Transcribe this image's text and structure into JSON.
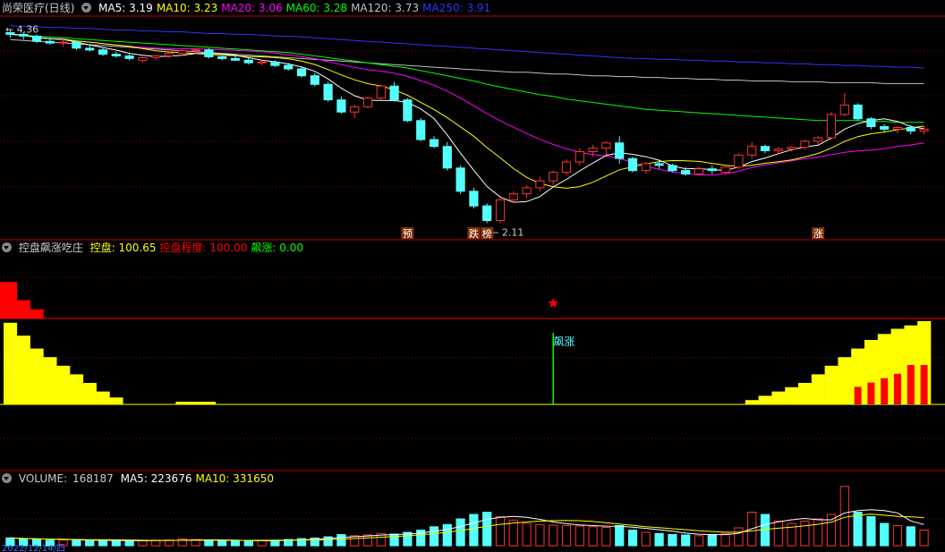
{
  "colors": {
    "up": "#ff3232",
    "down": "#54ffff",
    "ma5": "#ffffff",
    "ma10": "#ffff00",
    "ma20": "#ff00ff",
    "ma60": "#00ff00",
    "ma120": "#c0c0c0",
    "ma250": "#3232ff",
    "grid": "#800000",
    "panelBorder": "#c00000",
    "yellow": "#ffff00",
    "red": "#ff0000",
    "green": "#00ff00",
    "cyan": "#54ffff"
  },
  "main_panel": {
    "title": "尚荣医疗(日线)",
    "items": [
      {
        "label": "MA5:",
        "value": "3.19",
        "color": "#ffffff"
      },
      {
        "label": "MA10:",
        "value": "3.23",
        "color": "#ffff00"
      },
      {
        "label": "MA20:",
        "value": "3.06",
        "color": "#ff00ff"
      },
      {
        "label": "MA60:",
        "value": "3.28",
        "color": "#00ff00"
      },
      {
        "label": "MA120:",
        "value": "3.73",
        "color": "#c0c0c0"
      },
      {
        "label": "MA250:",
        "value": "3.91",
        "color": "#3232ff"
      }
    ],
    "high_label": "4.36",
    "low_label": "2.11",
    "markers": [
      {
        "text": "预",
        "i": 30
      },
      {
        "text": "跌",
        "i": 35
      },
      {
        "text": "榜",
        "i": 36
      },
      {
        "text": "涨",
        "i": 61
      }
    ]
  },
  "indicator_panel": {
    "title": "控盘飙涨吃庄",
    "items": [
      {
        "label": "控盘:",
        "value": "100.65",
        "color": "#ffff00"
      },
      {
        "label": "控盘程度:",
        "value": "100.00",
        "color": "#ff0000"
      },
      {
        "label": "飙涨:",
        "value": "0.00",
        "color": "#00ff00"
      }
    ],
    "signal_label": "飙涨"
  },
  "volume_panel": {
    "title": "VOLUME:",
    "value": "168187",
    "items": [
      {
        "label": "MA5:",
        "value": "223676",
        "color": "#ffffff"
      },
      {
        "label": "MA10:",
        "value": "331650",
        "color": "#ffff00"
      }
    ],
    "date_label": "2022/12/14/四"
  },
  "chart_data": {
    "type": "candlestick",
    "count": 70,
    "ylim": [
      2.0,
      4.45
    ],
    "ohlc": [
      [
        4.32,
        4.36,
        4.26,
        4.3
      ],
      [
        4.3,
        4.33,
        4.24,
        4.28
      ],
      [
        4.28,
        4.3,
        4.2,
        4.22
      ],
      [
        4.22,
        4.26,
        4.18,
        4.2
      ],
      [
        4.2,
        4.24,
        4.16,
        4.21
      ],
      [
        4.21,
        4.23,
        4.12,
        4.14
      ],
      [
        4.14,
        4.18,
        4.1,
        4.12
      ],
      [
        4.12,
        4.14,
        4.05,
        4.07
      ],
      [
        4.07,
        4.1,
        4.03,
        4.05
      ],
      [
        4.05,
        4.07,
        4.0,
        4.02
      ],
      [
        4.0,
        4.04,
        3.97,
        4.03
      ],
      [
        4.03,
        4.06,
        4.0,
        4.05
      ],
      [
        4.05,
        4.1,
        4.03,
        4.08
      ],
      [
        4.08,
        4.13,
        4.05,
        4.11
      ],
      [
        4.11,
        4.14,
        4.07,
        4.12
      ],
      [
        4.12,
        4.14,
        4.02,
        4.04
      ],
      [
        4.04,
        4.06,
        4.0,
        4.02
      ],
      [
        4.02,
        4.05,
        3.99,
        4.0
      ],
      [
        4.0,
        4.03,
        3.95,
        3.97
      ],
      [
        3.97,
        4.0,
        3.94,
        3.98
      ],
      [
        3.98,
        4.0,
        3.92,
        3.94
      ],
      [
        3.94,
        3.97,
        3.88,
        3.9
      ],
      [
        3.9,
        3.93,
        3.8,
        3.82
      ],
      [
        3.82,
        3.85,
        3.7,
        3.72
      ],
      [
        3.72,
        3.75,
        3.52,
        3.54
      ],
      [
        3.54,
        3.58,
        3.38,
        3.4
      ],
      [
        3.4,
        3.48,
        3.33,
        3.46
      ],
      [
        3.46,
        3.58,
        3.44,
        3.56
      ],
      [
        3.56,
        3.72,
        3.53,
        3.7
      ],
      [
        3.7,
        3.75,
        3.52,
        3.54
      ],
      [
        3.54,
        3.56,
        3.28,
        3.3
      ],
      [
        3.3,
        3.33,
        3.06,
        3.08
      ],
      [
        3.08,
        3.12,
        2.98,
        3.0
      ],
      [
        3.0,
        3.05,
        2.72,
        2.75
      ],
      [
        2.75,
        2.78,
        2.45,
        2.48
      ],
      [
        2.48,
        2.52,
        2.28,
        2.31
      ],
      [
        2.31,
        2.34,
        2.11,
        2.14
      ],
      [
        2.14,
        2.4,
        2.11,
        2.38
      ],
      [
        2.38,
        2.48,
        2.34,
        2.45
      ],
      [
        2.45,
        2.55,
        2.4,
        2.52
      ],
      [
        2.52,
        2.65,
        2.48,
        2.6
      ],
      [
        2.6,
        2.72,
        2.55,
        2.7
      ],
      [
        2.7,
        2.85,
        2.66,
        2.82
      ],
      [
        2.82,
        2.98,
        2.78,
        2.94
      ],
      [
        2.94,
        3.02,
        2.88,
        2.98
      ],
      [
        2.98,
        3.06,
        2.9,
        3.04
      ],
      [
        3.04,
        3.12,
        2.8,
        2.86
      ],
      [
        2.86,
        2.88,
        2.7,
        2.72
      ],
      [
        2.72,
        2.82,
        2.68,
        2.8
      ],
      [
        2.8,
        2.84,
        2.74,
        2.78
      ],
      [
        2.78,
        2.8,
        2.7,
        2.72
      ],
      [
        2.72,
        2.76,
        2.66,
        2.68
      ],
      [
        2.68,
        2.76,
        2.66,
        2.74
      ],
      [
        2.74,
        2.78,
        2.68,
        2.72
      ],
      [
        2.7,
        2.78,
        2.68,
        2.76
      ],
      [
        2.76,
        2.92,
        2.74,
        2.9
      ],
      [
        2.9,
        3.05,
        2.86,
        3.0
      ],
      [
        3.0,
        3.02,
        2.92,
        2.95
      ],
      [
        2.95,
        2.99,
        2.9,
        2.97
      ],
      [
        2.97,
        3.0,
        2.94,
        2.99
      ],
      [
        2.99,
        3.08,
        2.96,
        3.06
      ],
      [
        3.06,
        3.12,
        3.02,
        3.1
      ],
      [
        3.1,
        3.4,
        3.08,
        3.37
      ],
      [
        3.37,
        3.62,
        3.35,
        3.48
      ],
      [
        3.48,
        3.5,
        3.3,
        3.32
      ],
      [
        3.32,
        3.34,
        3.2,
        3.23
      ],
      [
        3.23,
        3.26,
        3.16,
        3.2
      ],
      [
        3.2,
        3.24,
        3.15,
        3.22
      ],
      [
        3.22,
        3.25,
        3.14,
        3.18
      ],
      [
        3.18,
        3.24,
        3.14,
        3.2
      ]
    ],
    "ma60": [
      4.3,
      4.29,
      4.28,
      4.27,
      4.26,
      4.25,
      4.24,
      4.23,
      4.22,
      4.21,
      4.2,
      4.19,
      4.18,
      4.17,
      4.16,
      4.15,
      4.14,
      4.13,
      4.12,
      4.11,
      4.1,
      4.09,
      4.07,
      4.05,
      4.03,
      4.01,
      3.99,
      3.97,
      3.95,
      3.93,
      3.91,
      3.88,
      3.85,
      3.82,
      3.79,
      3.76,
      3.72,
      3.69,
      3.66,
      3.63,
      3.6,
      3.58,
      3.55,
      3.53,
      3.51,
      3.49,
      3.47,
      3.45,
      3.43,
      3.42,
      3.41,
      3.4,
      3.39,
      3.38,
      3.37,
      3.36,
      3.35,
      3.34,
      3.33,
      3.32,
      3.31,
      3.3,
      3.3,
      3.3,
      3.3,
      3.29,
      3.29,
      3.28,
      3.28,
      3.28
    ],
    "ma120": [
      4.24,
      4.23,
      4.22,
      4.21,
      4.2,
      4.19,
      4.18,
      4.17,
      4.16,
      4.15,
      4.14,
      4.13,
      4.12,
      4.11,
      4.1,
      4.09,
      4.08,
      4.07,
      4.06,
      4.05,
      4.04,
      4.03,
      4.02,
      4.01,
      4.0,
      3.99,
      3.98,
      3.97,
      3.96,
      3.95,
      3.94,
      3.93,
      3.92,
      3.91,
      3.9,
      3.89,
      3.88,
      3.87,
      3.86,
      3.86,
      3.85,
      3.84,
      3.84,
      3.83,
      3.82,
      3.82,
      3.81,
      3.81,
      3.8,
      3.8,
      3.79,
      3.79,
      3.78,
      3.78,
      3.77,
      3.77,
      3.76,
      3.76,
      3.76,
      3.75,
      3.75,
      3.75,
      3.74,
      3.74,
      3.74,
      3.74,
      3.73,
      3.73,
      3.73,
      3.73
    ],
    "ma250": [
      4.4,
      4.39,
      4.39,
      4.38,
      4.38,
      4.37,
      4.37,
      4.36,
      4.35,
      4.35,
      4.34,
      4.34,
      4.33,
      4.33,
      4.32,
      4.31,
      4.31,
      4.3,
      4.3,
      4.29,
      4.28,
      4.28,
      4.27,
      4.26,
      4.25,
      4.24,
      4.23,
      4.22,
      4.21,
      4.2,
      4.19,
      4.18,
      4.17,
      4.16,
      4.15,
      4.14,
      4.13,
      4.12,
      4.11,
      4.1,
      4.09,
      4.08,
      4.07,
      4.06,
      4.05,
      4.04,
      4.03,
      4.02,
      4.02,
      4.01,
      4.01,
      4.0,
      4.0,
      3.99,
      3.99,
      3.98,
      3.98,
      3.97,
      3.97,
      3.96,
      3.96,
      3.95,
      3.95,
      3.94,
      3.94,
      3.93,
      3.93,
      3.92,
      3.92,
      3.91
    ],
    "kongpan": [
      95,
      80,
      65,
      55,
      45,
      35,
      25,
      15,
      8,
      0,
      0,
      0,
      0,
      3,
      3,
      3,
      0,
      0,
      0,
      0,
      0,
      0,
      0,
      0,
      0,
      0,
      0,
      0,
      0,
      0,
      0,
      0,
      0,
      0,
      0,
      0,
      0,
      0,
      0,
      0,
      0,
      0,
      0,
      0,
      0,
      0,
      0,
      0,
      0,
      0,
      0,
      0,
      0,
      0,
      0,
      0,
      5,
      10,
      15,
      20,
      25,
      35,
      45,
      55,
      65,
      75,
      82,
      88,
      92,
      97
    ],
    "kongpan_chengdu": [
      60,
      30,
      15,
      0
    ],
    "red_bars": [
      0,
      0,
      0,
      0,
      0,
      0,
      0,
      0,
      0,
      0,
      0,
      0,
      0,
      0,
      0,
      0,
      0,
      0,
      0,
      0,
      0,
      0,
      0,
      0,
      0,
      0,
      0,
      0,
      0,
      0,
      0,
      0,
      0,
      0,
      0,
      0,
      0,
      0,
      0,
      0,
      0,
      0,
      0,
      0,
      0,
      0,
      0,
      0,
      0,
      0,
      0,
      0,
      0,
      0,
      0,
      0,
      0,
      0,
      0,
      0,
      0,
      0,
      0,
      0,
      20,
      25,
      30,
      35,
      45,
      45
    ],
    "signal_index": 41,
    "star_index": 41,
    "volume": [
      35,
      30,
      28,
      25,
      26,
      24,
      22,
      24,
      25,
      20,
      22,
      25,
      26,
      30,
      28,
      24,
      22,
      20,
      22,
      24,
      25,
      28,
      32,
      35,
      40,
      50,
      45,
      48,
      55,
      52,
      60,
      70,
      85,
      95,
      120,
      140,
      150,
      130,
      115,
      100,
      95,
      92,
      90,
      88,
      85,
      82,
      90,
      70,
      60,
      55,
      50,
      48,
      45,
      50,
      55,
      80,
      150,
      140,
      110,
      100,
      110,
      120,
      140,
      265,
      150,
      130,
      100,
      90,
      85,
      70
    ],
    "vol_ylim": [
      0,
      280
    ]
  }
}
